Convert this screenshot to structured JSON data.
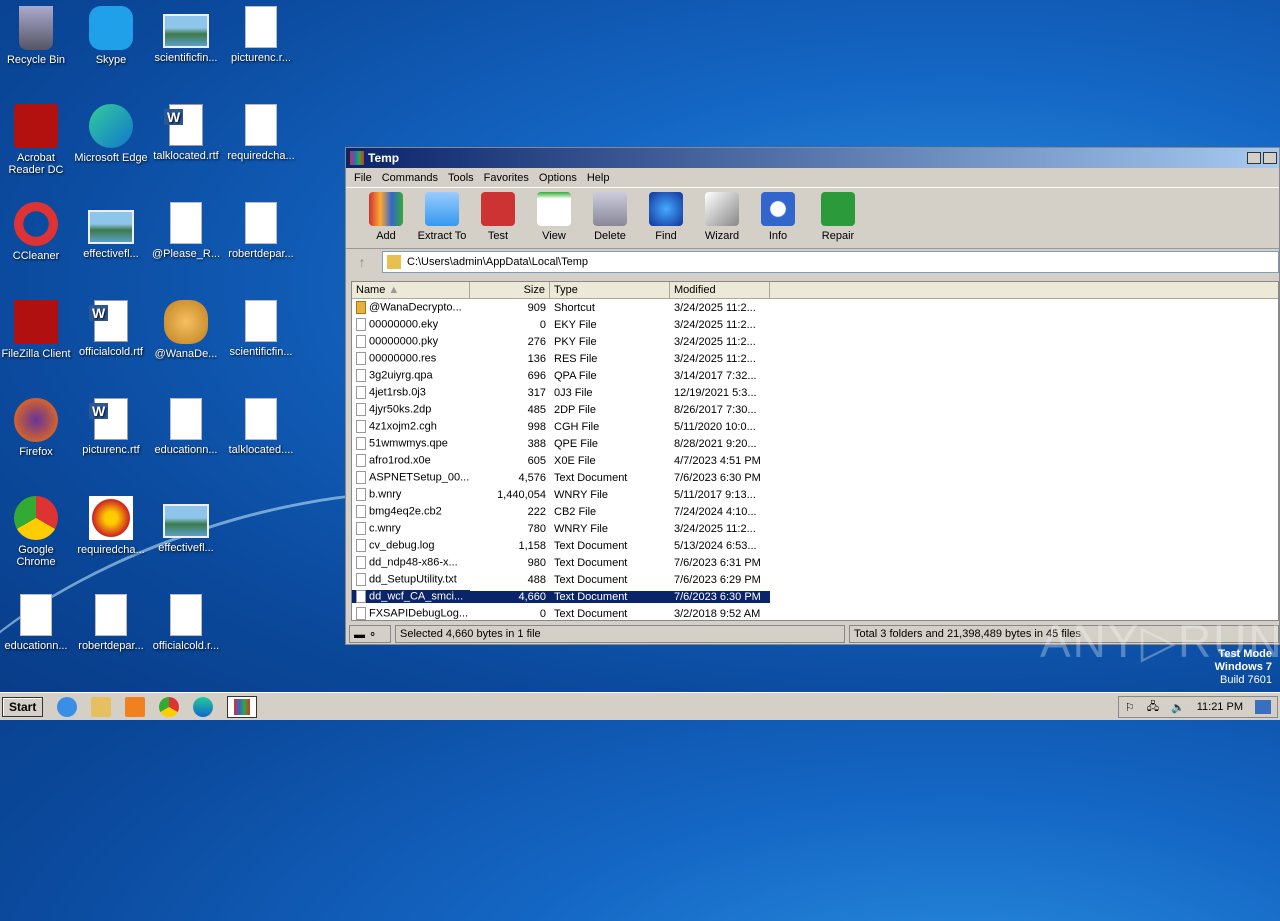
{
  "desktop": {
    "icons": [
      [
        "Recycle Bin",
        "Acrobat Reader DC",
        "CCleaner",
        "FileZilla Client",
        "Firefox",
        "Google Chrome",
        "educationn..."
      ],
      [
        "Skype",
        "Microsoft Edge",
        "effectivefl...",
        "officialcold.rtf",
        "picturenc.rtf",
        "requiredcha...",
        "robertdepar..."
      ],
      [
        "scientificfin...",
        "talklocated.rtf",
        "@Please_R...",
        "@WanaDe...",
        "educationn...",
        "effectivefl...",
        "officialcold.r..."
      ],
      [
        "picturenc.r...",
        "requiredcha...",
        "robertdepar...",
        "scientificfin...",
        "talklocated...."
      ]
    ]
  },
  "window": {
    "title": "Temp",
    "menu": [
      "File",
      "Commands",
      "Tools",
      "Favorites",
      "Options",
      "Help"
    ],
    "toolbar": [
      "Add",
      "Extract To",
      "Test",
      "View",
      "Delete",
      "Find",
      "Wizard",
      "Info",
      "Repair"
    ],
    "path": "C:\\Users\\admin\\AppData\\Local\\Temp",
    "columns": [
      "Name",
      "Size",
      "Type",
      "Modified"
    ],
    "files": [
      [
        "@WanaDecrypto...",
        "909",
        "Shortcut",
        "3/24/2025 11:2..."
      ],
      [
        "00000000.eky",
        "0",
        "EKY File",
        "3/24/2025 11:2..."
      ],
      [
        "00000000.pky",
        "276",
        "PKY File",
        "3/24/2025 11:2..."
      ],
      [
        "00000000.res",
        "136",
        "RES File",
        "3/24/2025 11:2..."
      ],
      [
        "3g2uiyrg.qpa",
        "696",
        "QPA File",
        "3/14/2017 7:32..."
      ],
      [
        "4jet1rsb.0j3",
        "317",
        "0J3 File",
        "12/19/2021 5:3..."
      ],
      [
        "4jyr50ks.2dp",
        "485",
        "2DP File",
        "8/26/2017 7:30..."
      ],
      [
        "4z1xojm2.cgh",
        "998",
        "CGH File",
        "5/11/2020 10:0..."
      ],
      [
        "51wmwmys.qpe",
        "388",
        "QPE File",
        "8/28/2021 9:20..."
      ],
      [
        "afro1rod.x0e",
        "605",
        "X0E File",
        "4/7/2023 4:51 PM"
      ],
      [
        "ASPNETSetup_00...",
        "4,576",
        "Text Document",
        "7/6/2023 6:30 PM"
      ],
      [
        "b.wnry",
        "1,440,054",
        "WNRY File",
        "5/11/2017 9:13..."
      ],
      [
        "bmg4eq2e.cb2",
        "222",
        "CB2 File",
        "7/24/2024 4:10..."
      ],
      [
        "c.wnry",
        "780",
        "WNRY File",
        "3/24/2025 11:2..."
      ],
      [
        "cv_debug.log",
        "1,158",
        "Text Document",
        "5/13/2024 6:53..."
      ],
      [
        "dd_ndp48-x86-x...",
        "980",
        "Text Document",
        "7/6/2023 6:31 PM"
      ],
      [
        "dd_SetupUtility.txt",
        "488",
        "Text Document",
        "7/6/2023 6:29 PM"
      ],
      [
        "dd_wcf_CA_smci...",
        "4,660",
        "Text Document",
        "7/6/2023 6:30 PM"
      ],
      [
        "FXSAPIDebugLog...",
        "0",
        "Text Document",
        "3/2/2018 9:52 AM"
      ]
    ],
    "selected_index": 17,
    "status_left": "Selected 4,660 bytes in 1 file",
    "status_right": "Total 3 folders and 21,398,489 bytes in 45 files"
  },
  "watermark": {
    "line1": "Test Mode",
    "line2": "Windows 7",
    "line3": "Build 7601",
    "brand": "ANY RUN"
  },
  "taskbar": {
    "start": "Start",
    "clock": "11:21 PM"
  }
}
